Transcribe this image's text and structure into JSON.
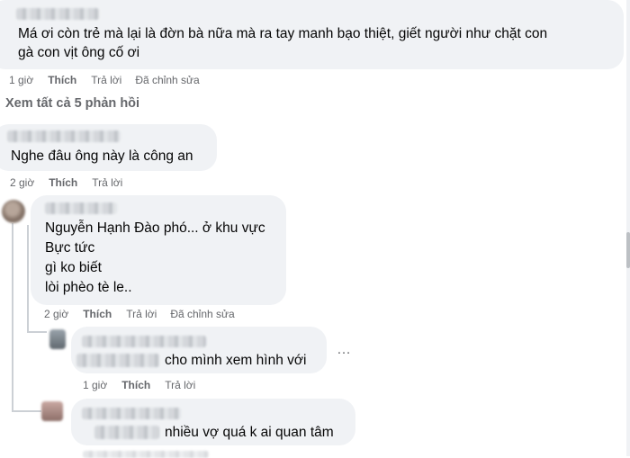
{
  "comments": [
    {
      "lines": [
        "Má ơi còn trẻ mà lại là đờn bà nữa mà ra tay manh bạo thiệt, giết người như chặt con",
        "gà con vịt ông cố ơi"
      ],
      "time": "1 giờ",
      "like": "Thích",
      "reply": "Trả lời",
      "edited": "Đã chỉnh sửa"
    },
    {
      "lines": [
        "Nghe đâu ông này là công an"
      ],
      "time": "2 giờ",
      "like": "Thích",
      "reply": "Trả lời"
    },
    {
      "lines": [
        "Nguyễn Hạnh Đào phó... ở khu vực",
        "Bực tức",
        "gì ko biết",
        "lòi phèo tè le.."
      ],
      "time": "2 giờ",
      "like": "Thích",
      "reply": "Trả lời",
      "edited": "Đã chỉnh sửa"
    },
    {
      "text": "cho mình xem hình với",
      "time": "1 giờ",
      "like": "Thích",
      "reply": "Trả lời"
    },
    {
      "text": "nhiều vợ quá k ai quan tâm"
    }
  ],
  "view_replies": "Xem tất cả 5 phản hồi",
  "more_options": "…",
  "colors": {
    "bubble": "#f0f2f5",
    "meta": "#65676b",
    "text": "#050505"
  }
}
